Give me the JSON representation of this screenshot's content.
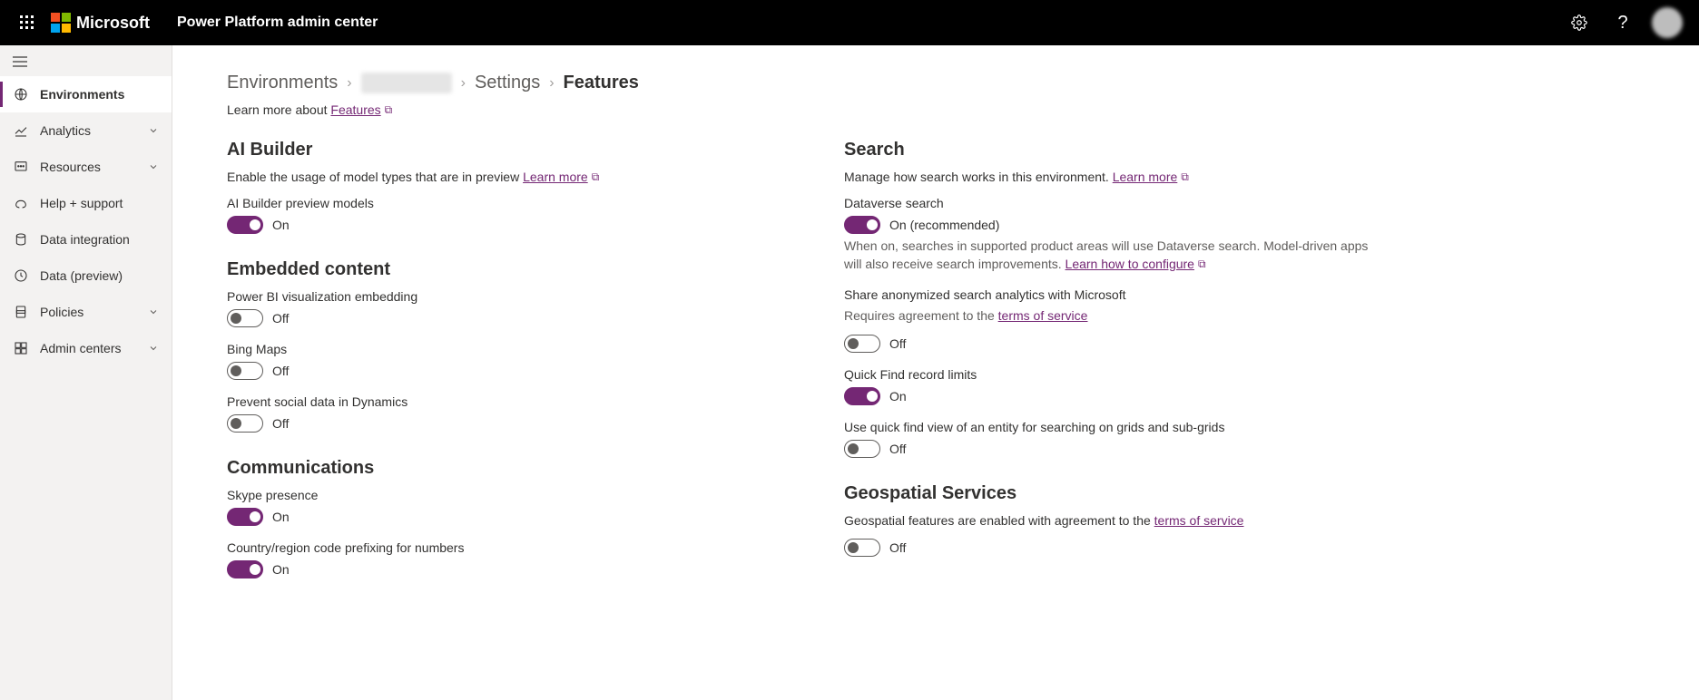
{
  "header": {
    "brand": "Microsoft",
    "app_title": "Power Platform admin center"
  },
  "sidebar": {
    "items": [
      {
        "label": "Environments",
        "icon": "environments",
        "active": true,
        "expandable": false
      },
      {
        "label": "Analytics",
        "icon": "analytics",
        "active": false,
        "expandable": true
      },
      {
        "label": "Resources",
        "icon": "resources",
        "active": false,
        "expandable": true
      },
      {
        "label": "Help + support",
        "icon": "help-support",
        "active": false,
        "expandable": false
      },
      {
        "label": "Data integration",
        "icon": "data-integration",
        "active": false,
        "expandable": false
      },
      {
        "label": "Data (preview)",
        "icon": "data-preview",
        "active": false,
        "expandable": false
      },
      {
        "label": "Policies",
        "icon": "policies",
        "active": false,
        "expandable": true
      },
      {
        "label": "Admin centers",
        "icon": "admin-centers",
        "active": false,
        "expandable": true
      }
    ]
  },
  "breadcrumb": {
    "c0": "Environments",
    "c1": "(redacted)",
    "c2": "Settings",
    "c3": "Features"
  },
  "learn": {
    "prefix": "Learn more about ",
    "link": "Features"
  },
  "left": {
    "ai_builder": {
      "title": "AI Builder",
      "desc": "Enable the usage of model types that are in preview ",
      "learn_more": "Learn more",
      "s1_label": "AI Builder preview models",
      "s1_state": "On"
    },
    "embedded": {
      "title": "Embedded content",
      "s1_label": "Power BI visualization embedding",
      "s1_state": "Off",
      "s2_label": "Bing Maps",
      "s2_state": "Off",
      "s3_label": "Prevent social data in Dynamics",
      "s3_state": "Off"
    },
    "comm": {
      "title": "Communications",
      "s1_label": "Skype presence",
      "s1_state": "On",
      "s2_label": "Country/region code prefixing for numbers",
      "s2_state": "On"
    }
  },
  "right": {
    "search": {
      "title": "Search",
      "desc": "Manage how search works in this environment. ",
      "learn_more": "Learn more",
      "s1_label": "Dataverse search",
      "s1_state": "On (recommended)",
      "s1_help_a": "When on, searches in supported product areas will use Dataverse search. Model-driven apps will also receive search improvements. ",
      "s1_help_link": "Learn how to configure",
      "s2_label": "Share anonymized search analytics with Microsoft",
      "s2_sub_a": "Requires agreement to the ",
      "s2_sub_link": "terms of service",
      "s2_state": "Off",
      "s3_label": "Quick Find record limits",
      "s3_state": "On",
      "s4_label": "Use quick find view of an entity for searching on grids and sub-grids",
      "s4_state": "Off"
    },
    "geo": {
      "title": "Geospatial Services",
      "desc_a": "Geospatial features are enabled with agreement to the ",
      "desc_link": "terms of service",
      "s1_state": "Off"
    }
  }
}
